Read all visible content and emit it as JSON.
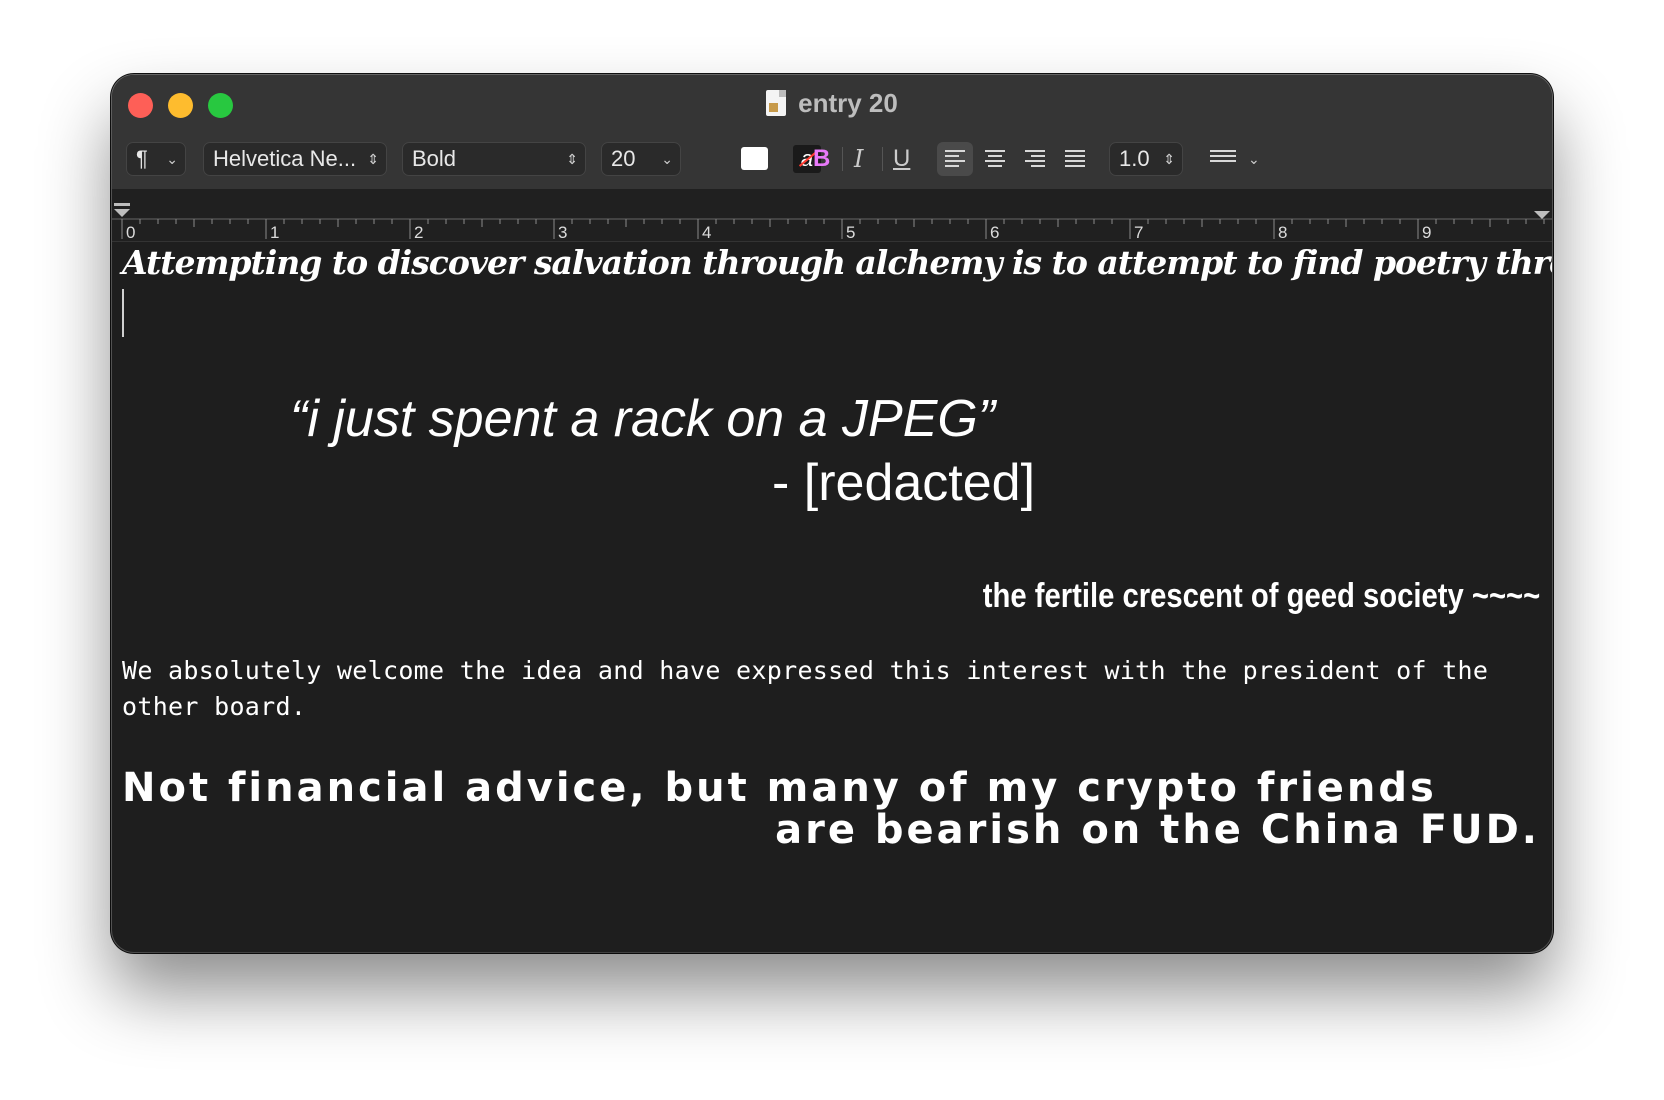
{
  "window": {
    "title": "entry 20"
  },
  "toolbar": {
    "paragraph_style_icon": "pilcrow-icon",
    "paragraph_glyph": "¶",
    "font_family": "Helvetica Ne...",
    "font_style": "Bold",
    "font_size": "20",
    "text_color": "#ffffff",
    "bold_label": "B",
    "italic_label": "I",
    "underline_label": "U",
    "bold_color": "#e879f9",
    "line_spacing": "1.0",
    "alignment_selected": "left"
  },
  "ruler": {
    "labels": [
      "0",
      "1",
      "2",
      "3",
      "4",
      "5",
      "6",
      "7",
      "8",
      "9"
    ]
  },
  "document": {
    "line1": "Attempting to discover salvation through alchemy is to attempt to find poetry through mathematics",
    "quote": "“i just spent a rack on a JPEG”",
    "attribution": "- [redacted]",
    "fertile": "the fertile crescent of geed society ~~~~",
    "mono_paragraph": "We absolutely welcome the idea and have expressed this interest with the president of the other board.",
    "wide_line1": "Not financial advice, but many of my crypto friends",
    "wide_line2": "are bearish on the China FUD."
  }
}
